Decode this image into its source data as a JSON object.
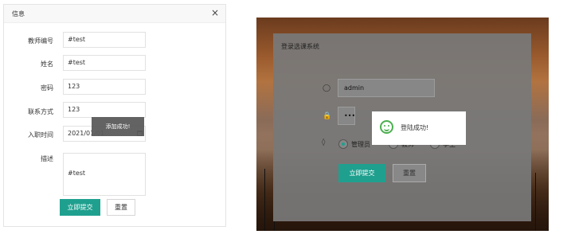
{
  "dialog": {
    "title": "信息",
    "close_icon": "×",
    "fields": {
      "teacher_no": {
        "label": "教师编号",
        "value": "#test"
      },
      "name": {
        "label": "姓名",
        "value": "#test"
      },
      "password": {
        "label": "密码",
        "value": "123"
      },
      "contact": {
        "label": "联系方式",
        "value": "123"
      },
      "hire_date": {
        "label": "入职时间",
        "value": "2021/01/01"
      },
      "description": {
        "label": "描述",
        "value": "#test"
      }
    },
    "submit_label": "立即提交",
    "reset_label": "重置",
    "toast": "添加成功!"
  },
  "login": {
    "title": "登录选课系统",
    "username": "admin",
    "password_mask": "•••",
    "roles": [
      "管理员",
      "教师",
      "学生"
    ],
    "selected_role": "管理员",
    "submit_label": "立即提交",
    "reset_label": "重置",
    "toast": "登陆成功!",
    "accent_color": "#1fa08f"
  }
}
